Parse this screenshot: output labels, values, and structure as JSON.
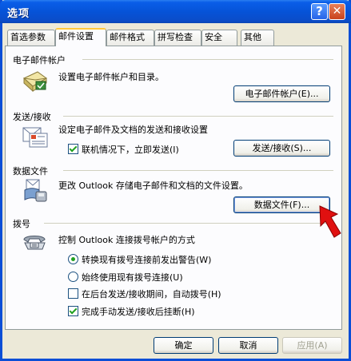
{
  "window": {
    "title": "选项",
    "help_glyph": "?",
    "close_glyph": "✕"
  },
  "tabs": [
    {
      "label": "首选参数",
      "active": false
    },
    {
      "label": "邮件设置",
      "active": true
    },
    {
      "label": "邮件格式",
      "active": false
    },
    {
      "label": "拼写检查",
      "active": false
    },
    {
      "label": "安全",
      "active": false
    },
    {
      "label": "其他",
      "active": false
    }
  ],
  "email_accounts": {
    "section": "电子邮件帐户",
    "description": "设置电子邮件帐户和目录。",
    "button": "电子邮件帐户(E)...",
    "icon": "mail-account-icon"
  },
  "send_receive": {
    "section": "发送/接收",
    "description": "设定电子邮件及文档的发送和接收设置",
    "checkbox": "联机情况下，立即发送(I)",
    "checked": true,
    "button": "发送/接收(S)...",
    "icon": "send-receive-icon"
  },
  "data_files": {
    "section": "数据文件",
    "description": "更改 Outlook 存储电子邮件和文档的文件设置。",
    "button": "数据文件(F)...",
    "icon": "data-files-icon"
  },
  "dialup": {
    "section": "拨号",
    "description": "控制 Outlook 连接拨号帐户的方式",
    "options": [
      {
        "type": "radio",
        "label": "转换现有拨号连接前发出警告(W)",
        "checked": true
      },
      {
        "type": "radio",
        "label": "始终使用现有拨号连接(U)",
        "checked": false
      },
      {
        "type": "checkbox",
        "label": "在后台发送/接收期间，自动拨号(H)",
        "checked": false
      },
      {
        "type": "checkbox",
        "label": "完成手动发送/接收后挂断(H)",
        "checked": true
      }
    ],
    "icon": "telephone-icon"
  },
  "footer": {
    "ok": "确定",
    "cancel": "取消",
    "apply": "应用(A)"
  },
  "colors": {
    "titlebar": "#0653D8",
    "arrow": "#E01010",
    "check": "#21A121"
  }
}
